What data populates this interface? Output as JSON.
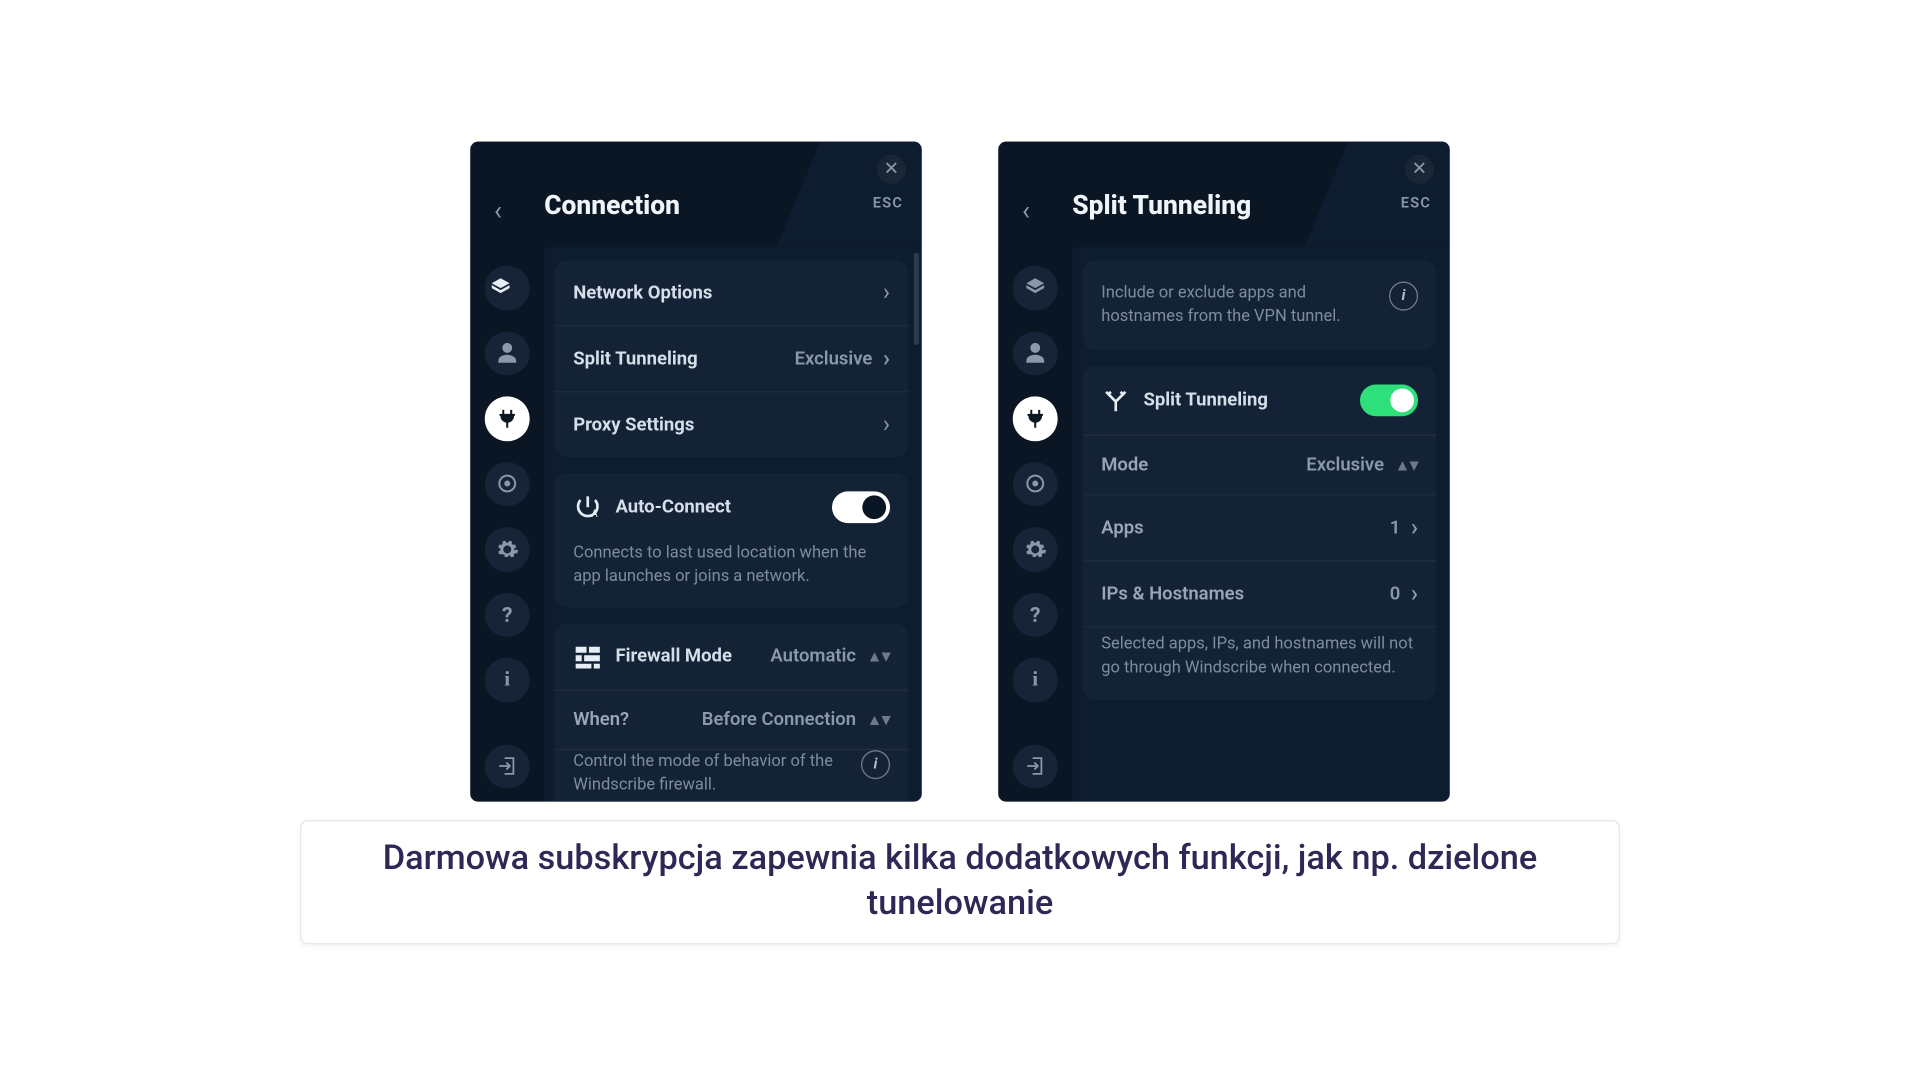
{
  "caption": "Darmowa subskrypcja zapewnia kilka dodatkowych funkcji, jak np. dzielone tunelowanie",
  "panelA": {
    "title": "Connection",
    "esc": "ESC",
    "rows": {
      "network_options": "Network Options",
      "split_tunneling": "Split Tunneling",
      "split_tunneling_value": "Exclusive",
      "proxy_settings": "Proxy Settings"
    },
    "auto_connect": {
      "label": "Auto-Connect",
      "desc": "Connects to last used location when the app launches or joins a network."
    },
    "firewall": {
      "label": "Firewall Mode",
      "value": "Automatic",
      "when_label": "When?",
      "when_value": "Before Connection",
      "desc": "Control the mode of behavior of the Windscribe firewall."
    }
  },
  "panelB": {
    "title": "Split Tunneling",
    "esc": "ESC",
    "intro": "Include or exclude apps and hostnames from the VPN tunnel.",
    "toggle_label": "Split Tunneling",
    "mode_label": "Mode",
    "mode_value": "Exclusive",
    "apps_label": "Apps",
    "apps_value": "1",
    "ips_label": "IPs & Hostnames",
    "ips_value": "0",
    "footnote": "Selected apps, IPs, and hostnames will not go through Windscribe when connected."
  }
}
